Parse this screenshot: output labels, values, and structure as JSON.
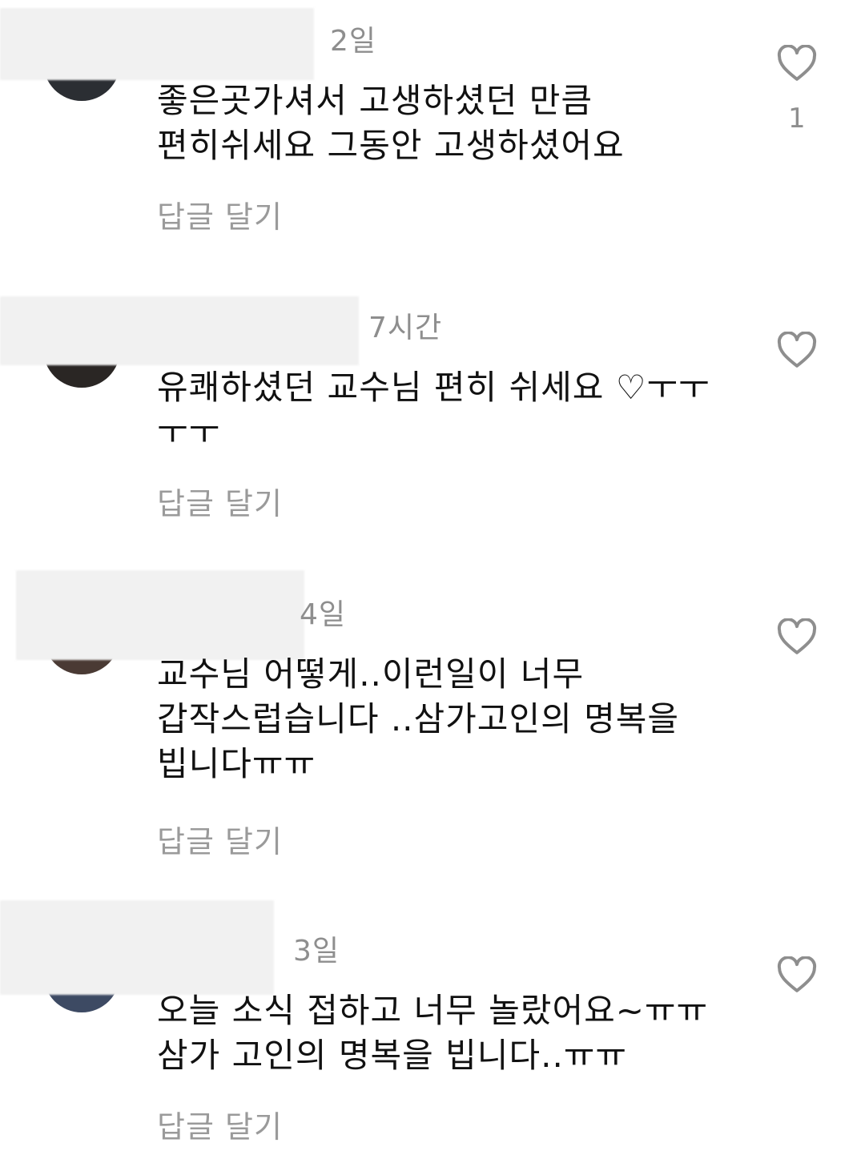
{
  "comments": [
    {
      "time": "2일",
      "text": "좋은곳가셔서 고생하셨던 만큼\n편히쉬세요 그동안 고생하셨어요",
      "reply": "답글 달기",
      "likes": "1",
      "avatar_color": "#2b2e33"
    },
    {
      "time": "7시간",
      "text": "유쾌하셨던 교수님 편히 쉬세요 ♡ㅜㅜ\nㅜㅜ",
      "reply": "답글 달기",
      "likes": "",
      "avatar_color": "#2a2624"
    },
    {
      "time": "4일",
      "text": "교수님 어떻게..이런일이 너무\n갑작스럽습니다 ..삼가고인의 명복을\n빕니다ㅠㅠ",
      "reply": "답글 달기",
      "likes": "",
      "avatar_color": "#4a3a34"
    },
    {
      "time": "3일",
      "text": "오늘 소식 접하고 너무 놀랐어요~ㅠㅠ\n삼가 고인의 명복을 빕니다..ㅠㅠ",
      "reply": "답글 달기",
      "likes": "",
      "avatar_color": "#3d4a63"
    }
  ],
  "icons": {
    "like": "heart-outline-icon"
  },
  "colors": {
    "meta_text": "#8e8e8e",
    "body_text": "#111111",
    "redaction": "#f1f1f1"
  }
}
